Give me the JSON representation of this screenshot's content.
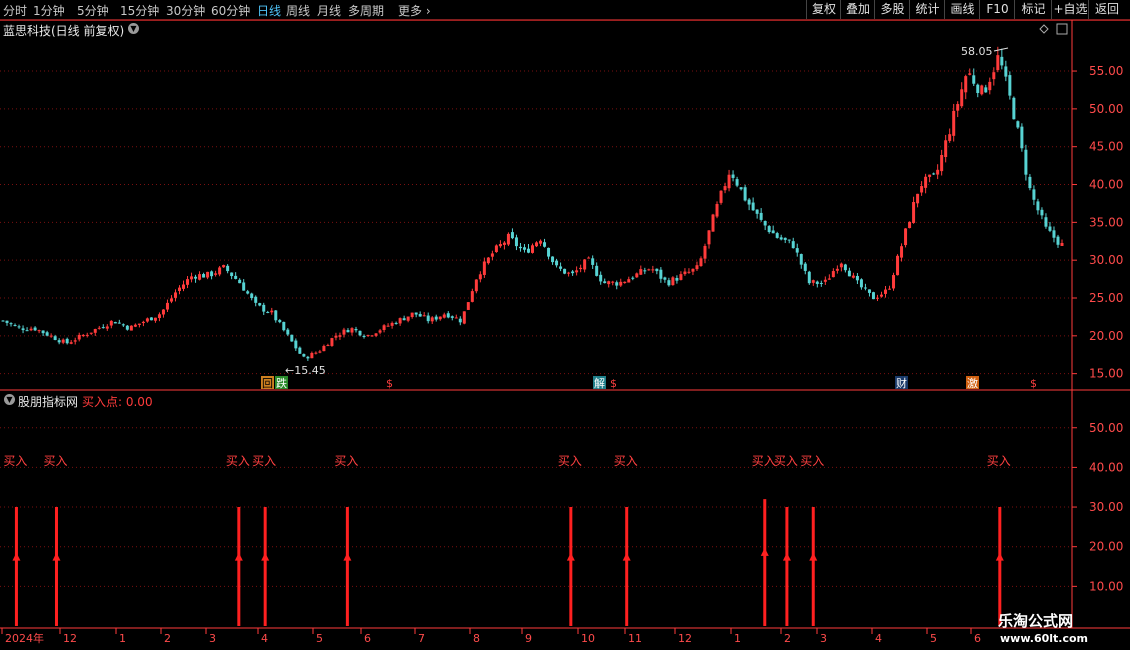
{
  "toolbar": {
    "periods": [
      "分时",
      "1分钟",
      "5分钟",
      "15分钟",
      "30分钟",
      "60分钟",
      "日线",
      "周线",
      "月线",
      "多周期",
      "更多"
    ],
    "active": "日线",
    "right": [
      "复权",
      "叠加",
      "多股",
      "统计",
      "画线",
      "F10",
      "标记",
      "+自选",
      "返回"
    ]
  },
  "stock": {
    "title": "蓝思科技(日线 前复权)"
  },
  "indicator": {
    "title": "股朋指标网",
    "value_label": "买入点: 0.00"
  },
  "markers": {
    "price_labels": [
      {
        "text": "58.05",
        "value": 58.05
      },
      {
        "text": "15.45",
        "value": 15.45
      }
    ],
    "events": [
      "回",
      "跌",
      "$",
      "解",
      "$",
      "财",
      "激",
      "$"
    ]
  },
  "colors": {
    "up": "#ff3b3b",
    "down": "#57d3d3",
    "grid": "#7a1010",
    "axis": "#ff3b3b",
    "signal": "#ff2020"
  },
  "icons": [
    "chevron-down-icon",
    "diamond-icon",
    "panel-toggle-icon"
  ],
  "watermark": {
    "line1": "乐淘公式网",
    "line2": "www.60lt.com"
  },
  "chart_data": [
    {
      "type": "candlestick",
      "ylim": [
        13.5,
        59.5
      ],
      "yticks": [
        "55.00",
        "50.00",
        "45.00",
        "40.00",
        "35.00",
        "30.00",
        "25.00",
        "20.00",
        "15.00"
      ],
      "xticks": [
        "2024年",
        "12",
        "1",
        "2",
        "3",
        "4",
        "5",
        "6",
        "7",
        "8",
        "9",
        "10",
        "11",
        "12",
        "1",
        "2",
        "3",
        "4",
        "5",
        "6"
      ],
      "approx_close_path": [
        22,
        21,
        21,
        20,
        19,
        20,
        21,
        22,
        21,
        22,
        23,
        26,
        28,
        28,
        29,
        27,
        24,
        23,
        20,
        17,
        18,
        20,
        21,
        20,
        21,
        22,
        23,
        22,
        23,
        22,
        28,
        31,
        33,
        31,
        33,
        29,
        28,
        30,
        27,
        27,
        28,
        29,
        27,
        28,
        29,
        36,
        42,
        38,
        35,
        33,
        32,
        27,
        27,
        30,
        27,
        25,
        26,
        33,
        40,
        41,
        48,
        55,
        52,
        57,
        49,
        39,
        34,
        32
      ]
    },
    {
      "type": "signal",
      "ylim": [
        0,
        57
      ],
      "yticks": [
        "50.00",
        "40.00",
        "30.00",
        "20.00",
        "10.00"
      ],
      "signal_label": "买入",
      "signals": [
        {
          "x": 0.008,
          "value": 30
        },
        {
          "x": 0.046,
          "value": 30
        },
        {
          "x": 0.219,
          "value": 30
        },
        {
          "x": 0.244,
          "value": 30
        },
        {
          "x": 0.322,
          "value": 30
        },
        {
          "x": 0.534,
          "value": 30
        },
        {
          "x": 0.587,
          "value": 30
        },
        {
          "x": 0.718,
          "value": 32
        },
        {
          "x": 0.739,
          "value": 30
        },
        {
          "x": 0.764,
          "value": 30
        },
        {
          "x": 0.941,
          "value": 30
        }
      ]
    }
  ]
}
